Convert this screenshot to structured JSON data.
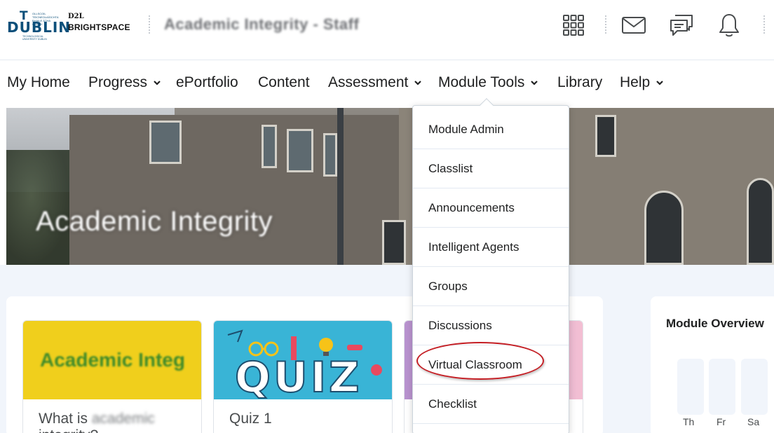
{
  "header": {
    "logo": {
      "tu_letter": "T",
      "tu_word": "DUBLIN",
      "tu_tagline": "OLLSCOIL TEICNEOLAÍOCHTA BHAILE ÁTHA CLIATH",
      "tu_tagline2": "TECHNOLOGICAL UNIVERSITY DUBLIN",
      "d2l": "D2L",
      "brightspace": "BRIGHTSPACE"
    },
    "course_title": "Academic Integrity - Staff",
    "icons": [
      "waffle-icon",
      "mail-icon",
      "chat-icon",
      "bell-icon"
    ]
  },
  "nav": {
    "items": [
      {
        "label": "My Home",
        "has_menu": false
      },
      {
        "label": "Progress",
        "has_menu": true
      },
      {
        "label": "ePortfolio",
        "has_menu": false
      },
      {
        "label": "Content",
        "has_menu": false
      },
      {
        "label": "Assessment",
        "has_menu": true
      },
      {
        "label": "Module Tools",
        "has_menu": true
      },
      {
        "label": "Library",
        "has_menu": false
      },
      {
        "label": "Help",
        "has_menu": true
      }
    ]
  },
  "banner": {
    "title": "Academic Integrity"
  },
  "dropdown": {
    "items": [
      "Module Admin",
      "Classlist",
      "Announcements",
      "Intelligent Agents",
      "Groups",
      "Discussions",
      "Virtual Classroom",
      "Checklist"
    ],
    "highlighted": "Virtual Classroom",
    "highlight_color": "#c41e24"
  },
  "cards": [
    {
      "thumb_text": "Academic Integ",
      "title_prefix": "What is",
      "title_blurred": "academic",
      "title_suffix": "integrity?",
      "thumb_color": "#f0cf1c"
    },
    {
      "thumb_text": "QUIZ",
      "title": "Quiz 1",
      "thumb_color": "#39b4d6"
    },
    {
      "thumb_color": "#e7b7d0"
    }
  ],
  "module_overview": {
    "title": "Module Overview",
    "days": [
      "Th",
      "Fr",
      "Sa"
    ]
  },
  "colors": {
    "brand": "#0b4f7a",
    "text": "#202122",
    "page_bg": "#f1f5fb"
  }
}
